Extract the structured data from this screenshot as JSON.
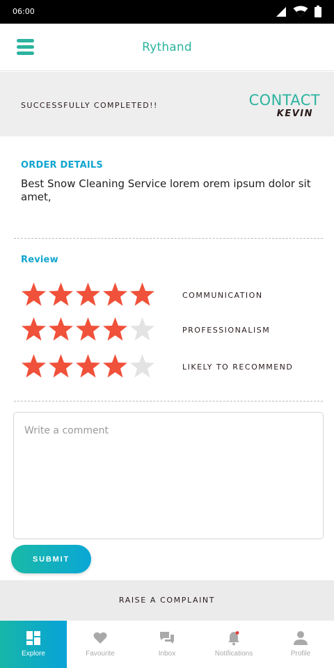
{
  "status_bar": {
    "time": "06:00"
  },
  "header": {
    "title": "Rythand",
    "menu_icon": "hamburger-menu-icon"
  },
  "banner": {
    "status_text": "SUCCESSFULLY COMPLETED!!",
    "contact_label": "CONTACT",
    "contact_name": "KEVIN"
  },
  "order": {
    "heading": "ORDER DETAILS",
    "description": "Best Snow Cleaning Service lorem orem ipsum dolor sit amet,"
  },
  "review": {
    "heading": "Review",
    "max_stars": 5,
    "ratings": [
      {
        "label": "COMMUNICATION",
        "stars": 5
      },
      {
        "label": "PROFESSIONALISM",
        "stars": 4
      },
      {
        "label": "LIKELY TO RECOMMEND",
        "stars": 4
      }
    ]
  },
  "comment": {
    "placeholder": "Write a comment",
    "value": ""
  },
  "actions": {
    "submit_label": "SUBMIT",
    "complaint_label": "RAISE A COMPLAINT"
  },
  "bottom_nav": {
    "items": [
      {
        "label": "Explore",
        "icon": "explore-grid-icon",
        "active": true
      },
      {
        "label": "Favourite",
        "icon": "heart-icon",
        "active": false
      },
      {
        "label": "Inbox",
        "icon": "chat-icon",
        "active": false
      },
      {
        "label": "Notifications",
        "icon": "bell-icon",
        "active": false
      },
      {
        "label": "Profile",
        "icon": "person-icon",
        "active": false
      }
    ]
  },
  "colors": {
    "accent": "#2bb39f",
    "heading_blue": "#10a5cf",
    "star_filled": "#f0513a",
    "star_empty": "#e3e3e3",
    "nav_inactive": "#a9a9a9",
    "notification_dot": "#e53935"
  }
}
